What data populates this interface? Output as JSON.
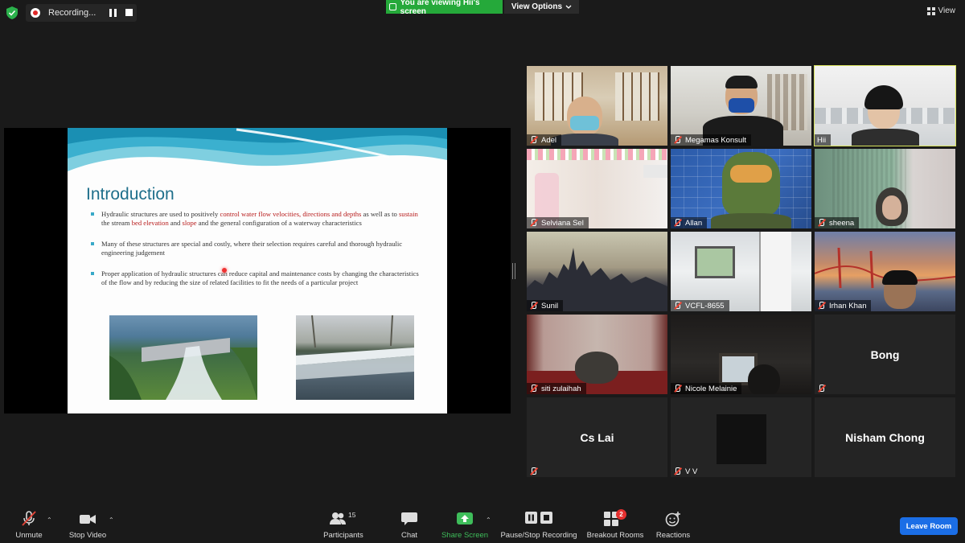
{
  "top_bar": {
    "recording_label": "Recording...",
    "viewing_banner": "You are viewing Hii's screen",
    "view_options_label": "View Options",
    "view_label": "View",
    "icons": {
      "security": "shield-check-icon",
      "pause": "pause-icon",
      "stop": "stop-icon",
      "chevron": "chevron-down-icon",
      "grid": "grid-view-icon"
    }
  },
  "slide": {
    "title": "Introduction",
    "bullet1": {
      "p1": "Hydraulic structures are used to positively ",
      "h1": "control water flow velocities, directions and depths",
      "p2": " as well as to ",
      "h2": "sustain",
      "p3": " the stream ",
      "h3": "bed elevation",
      "p4": " and ",
      "h4": "slope",
      "p5": " and the general configuration of a waterway characteristics"
    },
    "bullet2": "Many of these structures are special and costly, where their selection requires careful and thorough hydraulic engineering judgement",
    "bullet3": "Proper application of hydraulic structures can reduce capital and maintenance costs by changing the characteristics of the flow and by reducing the size of related facilities to fit the needs of a particular project",
    "accent_color": "#1f6f8b",
    "highlight_color": "#b81c1c"
  },
  "participants_gallery": [
    {
      "name": "Adel"
    },
    {
      "name": "Megamas Konsult"
    },
    {
      "name": "Hii"
    },
    {
      "name": "Selviana Sel"
    },
    {
      "name": "Allan"
    },
    {
      "name": "sheena"
    },
    {
      "name": "Sunil"
    },
    {
      "name": "VCFL-8655"
    },
    {
      "name": "Irhan Khan"
    },
    {
      "name": "siti zulaihah"
    },
    {
      "name": "Nicole Melainie"
    },
    {
      "big_name": "Bong"
    },
    {
      "big_name": "Cs Lai"
    },
    {
      "name": "V V"
    },
    {
      "big_name": "Nisham Chong"
    }
  ],
  "toolbar": {
    "unmute": "Unmute",
    "stop_video": "Stop Video",
    "participants": "Participants",
    "participants_count": "15",
    "chat": "Chat",
    "share_screen": "Share Screen",
    "pause_stop_recording": "Pause/Stop Recording",
    "breakout_rooms": "Breakout Rooms",
    "breakout_badge": "2",
    "reactions": "Reactions",
    "leave_room": "Leave Room",
    "share_color": "#3ebd5a",
    "leave_color": "#1b6ee6"
  }
}
